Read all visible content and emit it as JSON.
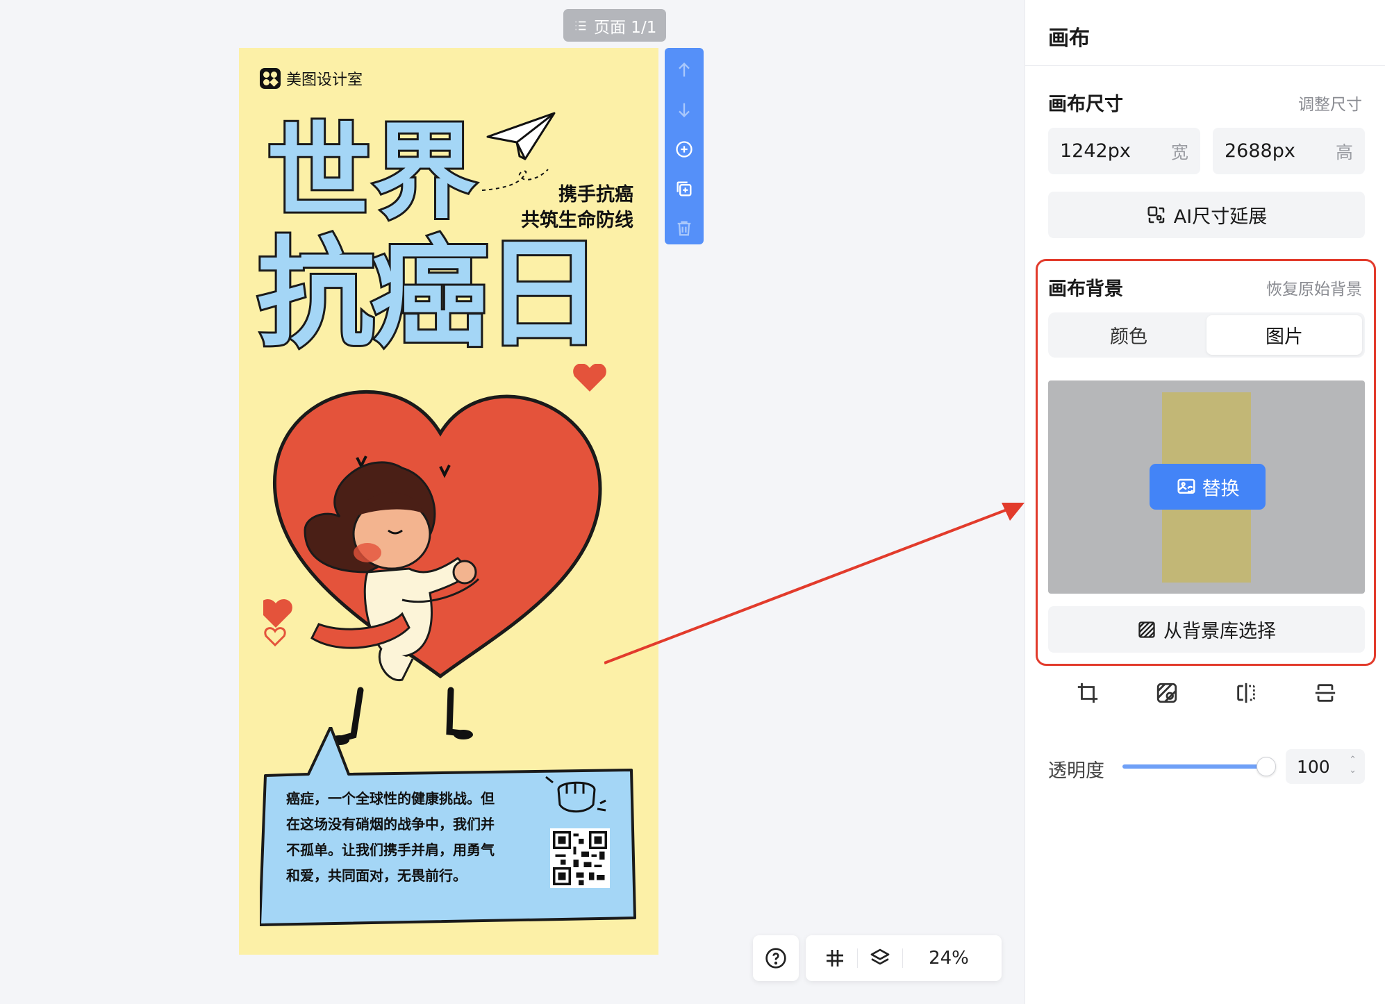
{
  "workspace": {
    "page_chip": "页面 1/1",
    "zoom": "24%"
  },
  "poster": {
    "brand": "美图设计室",
    "title_line1": "世界",
    "title_line2": "抗癌日",
    "subtitle_line1": "携手抗癌",
    "subtitle_line2": "共筑生命防线",
    "body_lines": [
      "癌症，一个全球性的健康挑战。但",
      "在这场没有硝烟的战争中，我们并",
      "不孤单。让我们携手并肩，用勇气",
      "和爱，共同面对，无畏前行。"
    ],
    "colors": {
      "background": "#fcf0a7",
      "title_fill": "#a4d6f6",
      "heart": "#e4533b",
      "bubble": "#a4d6f6"
    }
  },
  "side_toolbar": {
    "items": [
      "arrow-up-icon",
      "arrow-down-icon",
      "add-page-icon",
      "duplicate-page-icon",
      "delete-icon"
    ]
  },
  "panel": {
    "title": "画布",
    "size_section": {
      "title": "画布尺寸",
      "link": "调整尺寸",
      "width_value": "1242px",
      "width_unit": "宽",
      "height_value": "2688px",
      "height_unit": "高",
      "ai_button": "AI尺寸延展"
    },
    "bg_section": {
      "title": "画布背景",
      "link": "恢复原始背景",
      "tabs": [
        {
          "label": "颜色",
          "active": false
        },
        {
          "label": "图片",
          "active": true
        }
      ],
      "replace_button": "替换",
      "library_button": "从背景库选择"
    },
    "icon_row": [
      "crop-icon",
      "texture-icon",
      "flip-horizontal-icon",
      "flip-vertical-icon"
    ],
    "opacity": {
      "label": "透明度",
      "value": "100",
      "level": 1.0
    },
    "accent_color": "#4384f7",
    "highlight_color": "#e23b2c"
  }
}
